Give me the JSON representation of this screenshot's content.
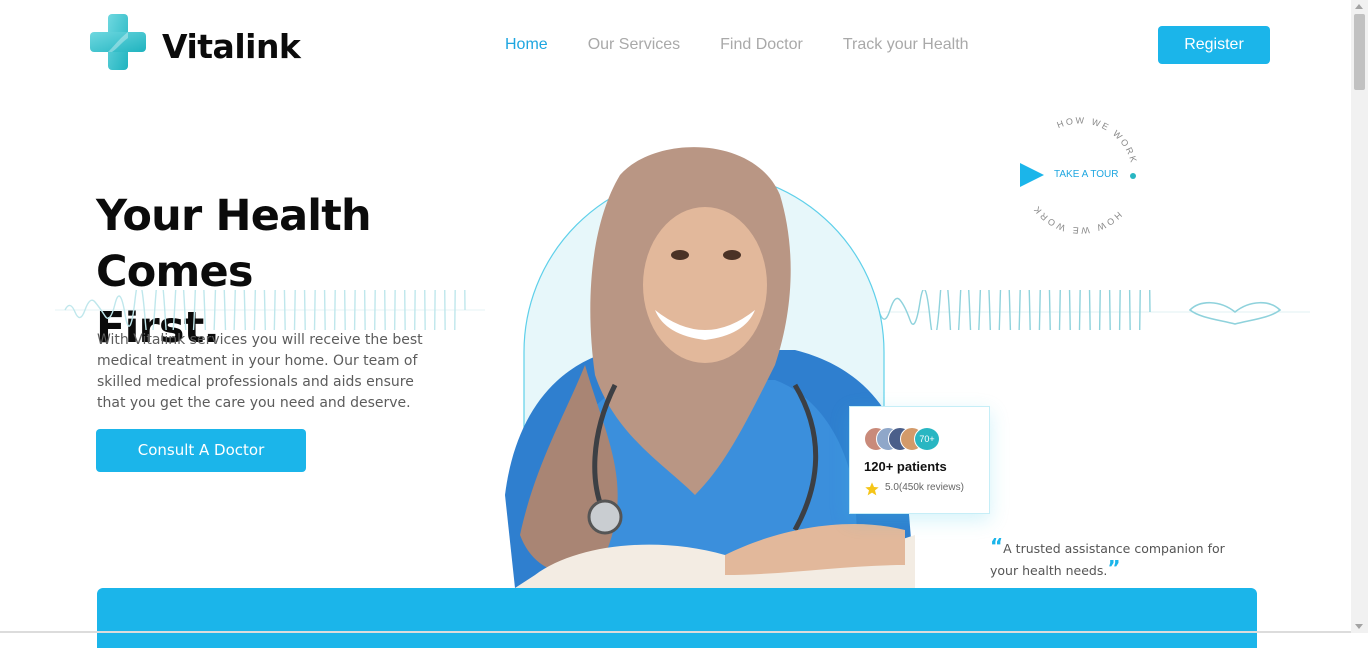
{
  "brand": {
    "name": "Vitalink",
    "logo_icon": "medical-cross-icon",
    "accent_color": "#1bb5ea",
    "teal_color": "#29b6c2"
  },
  "nav": {
    "items": [
      {
        "label": "Home",
        "active": true
      },
      {
        "label": "Our Services",
        "active": false
      },
      {
        "label": "Find Doctor",
        "active": false
      },
      {
        "label": "Track your Health",
        "active": false
      }
    ],
    "register_label": "Register"
  },
  "hero": {
    "title_line1": "Your Health Comes",
    "title_line2": "First.",
    "description": "With Vitalink services you will receive the best medical treatment in your home. Our team of skilled medical professionals and aids ensure that you get the care you need and deserve.",
    "cta_label": "Consult A Doctor"
  },
  "tour": {
    "ring_text": "HOW WE WORK",
    "label": "TAKE A TOUR",
    "icon": "play-icon"
  },
  "patients_card": {
    "badge": "70+",
    "count_label": "120+ patients",
    "rating_label": "5.0(450k reviews)",
    "icon": "star-icon"
  },
  "quote": {
    "open_mark": "“",
    "text": "A trusted assistance companion for your health needs.",
    "close_mark": "”"
  }
}
